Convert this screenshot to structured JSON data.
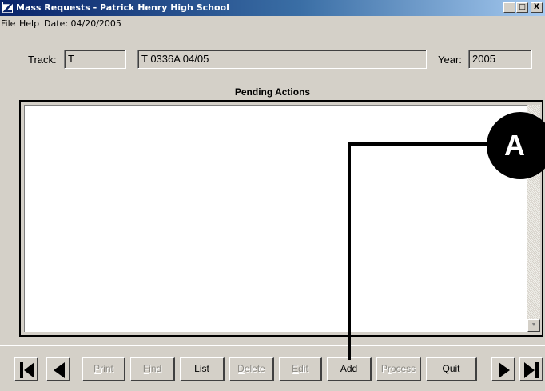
{
  "window": {
    "title": "Mass Requests - Patrick Henry High School",
    "controls": {
      "minimize": "_",
      "maximize": "□",
      "close": "X"
    }
  },
  "menu": {
    "file": "File",
    "help": "Help",
    "date": "Date: 04/20/2005"
  },
  "form": {
    "track_label": "Track:",
    "track_value": "T",
    "track_description": "T 0336A 04/05",
    "year_label": "Year:",
    "year_value": "2005"
  },
  "pending": {
    "title": "Pending Actions",
    "items": []
  },
  "toolbar": {
    "print": {
      "pre": "",
      "u": "P",
      "post": "rint"
    },
    "find": {
      "pre": "",
      "u": "F",
      "post": "ind"
    },
    "list": {
      "pre": "",
      "u": "L",
      "post": "ist"
    },
    "delete": {
      "pre": "",
      "u": "D",
      "post": "elete"
    },
    "edit": {
      "pre": "",
      "u": "E",
      "post": "dit"
    },
    "add": {
      "pre": "",
      "u": "A",
      "post": "dd"
    },
    "process": {
      "pre": "P",
      "u": "r",
      "post": "ocess"
    },
    "quit": {
      "pre": "",
      "u": "Q",
      "post": "uit"
    }
  },
  "annotation": {
    "label": "A"
  },
  "icons": {
    "first": "first-record-icon",
    "previous": "previous-record-icon",
    "next": "next-record-icon",
    "last": "last-record-icon"
  },
  "colors": {
    "titlebar_start": "#0a246a",
    "titlebar_end": "#a6caf0",
    "window_bg": "#d4d0c8"
  }
}
